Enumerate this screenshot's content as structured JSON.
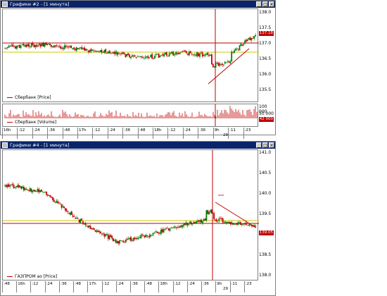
{
  "window_top": {
    "title": "Графики #2 - [1 минута]",
    "legend_price": "Сбербанк [Price]",
    "legend_volume": "Сбербанк [Volume]",
    "price_axis": [
      "138.0",
      "137.5",
      "137.0",
      "136.5",
      "136.0",
      "135.5"
    ],
    "price_tag": "137.18",
    "volume_axis": [
      "100 000",
      "50 000"
    ],
    "volume_tag": "42 000",
    "time_axis": [
      "16h",
      ":12",
      ":24",
      ":36",
      ":48",
      "17h",
      ":12",
      ":24",
      ":36",
      ":48",
      "18h",
      ":12",
      ":24",
      ":36",
      "9h",
      ":11",
      ":23"
    ],
    "date_label": "29"
  },
  "window_bottom": {
    "title": "Графики #4 - [1 минута]",
    "legend_price": "ГАЗПРОМ ао [Price]",
    "price_axis": [
      "141.0",
      "140.5",
      "140.0",
      "139.5",
      "139.0",
      "138.5",
      "138.0"
    ],
    "price_tag": "139.05",
    "time_axis": [
      ":48",
      "16h",
      ":12",
      ":24",
      ":36",
      ":48",
      "17h",
      ":12",
      ":24",
      ":36",
      ":48",
      "18h",
      ":12",
      ":24",
      ":36",
      "9h",
      ":11",
      ":23"
    ],
    "date_label": "29"
  },
  "colors": {
    "up": "#008000",
    "down": "#c00000",
    "support": "#c8c800",
    "resistance": "#c00000",
    "cursor": "#c00000"
  },
  "icons": [
    "window-icon",
    "minimize-icon",
    "maximize-icon",
    "close-icon"
  ]
}
